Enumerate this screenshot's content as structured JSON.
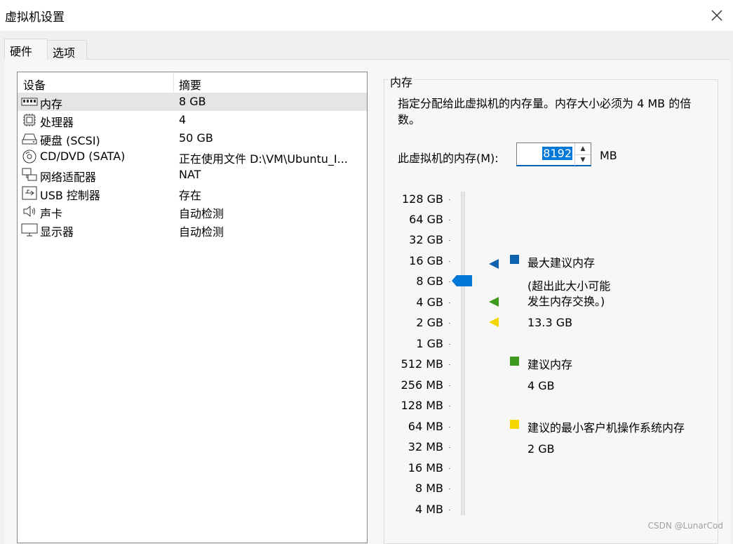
{
  "window": {
    "title": "虚拟机设置",
    "close_icon": "close-icon"
  },
  "tabs": [
    {
      "label": "硬件"
    },
    {
      "label": "选项"
    }
  ],
  "device_list": {
    "columns": [
      "设备",
      "摘要"
    ],
    "rows": [
      {
        "icon": "memory-icon",
        "name": "内存",
        "summary": "8 GB"
      },
      {
        "icon": "processor-icon",
        "name": "处理器",
        "summary": "4"
      },
      {
        "icon": "hard-disk-icon",
        "name": "硬盘 (SCSI)",
        "summary": "50 GB"
      },
      {
        "icon": "cd-dvd-icon",
        "name": "CD/DVD (SATA)",
        "summary": "正在使用文件 D:\\VM\\Ubuntu_I..."
      },
      {
        "icon": "network-adapter-icon",
        "name": "网络适配器",
        "summary": "NAT"
      },
      {
        "icon": "usb-controller-icon",
        "name": "USB 控制器",
        "summary": "存在"
      },
      {
        "icon": "sound-card-icon",
        "name": "声卡",
        "summary": "自动检测"
      },
      {
        "icon": "display-icon",
        "name": "显示器",
        "summary": "自动检测"
      }
    ]
  },
  "memory": {
    "group_label": "内存",
    "description": "指定分配给此虚拟机的内存量。内存大小必须为 4 MB 的倍数。",
    "field_label": "此虚拟机的内存(M):",
    "value": "8192",
    "unit": "MB",
    "scale": [
      "128 GB",
      "64 GB",
      "32 GB",
      "16 GB",
      "8 GB",
      "4 GB",
      "2 GB",
      "1 GB",
      "512 MB",
      "256 MB",
      "128 MB",
      "64 MB",
      "32 MB",
      "16 MB",
      "8 MB",
      "4 MB"
    ],
    "current_level": "8 GB",
    "max_recommended_level": "16 GB",
    "recommended_level": "4 GB",
    "min_guest_level": "2 GB",
    "legend": {
      "max_recommended": {
        "label": "最大建议内存",
        "note_line1": "(超出此大小可能",
        "note_line2": "发生内存交换。)",
        "value": "13.3 GB",
        "color": "#0e63b1"
      },
      "recommended": {
        "label": "建议内存",
        "value": "4 GB",
        "color": "#3c9a1d"
      },
      "min_guest": {
        "label": "建议的最小客户机操作系统内存",
        "value": "2 GB",
        "color": "#f4d700"
      }
    }
  },
  "watermark": "CSDN @LunarCod"
}
